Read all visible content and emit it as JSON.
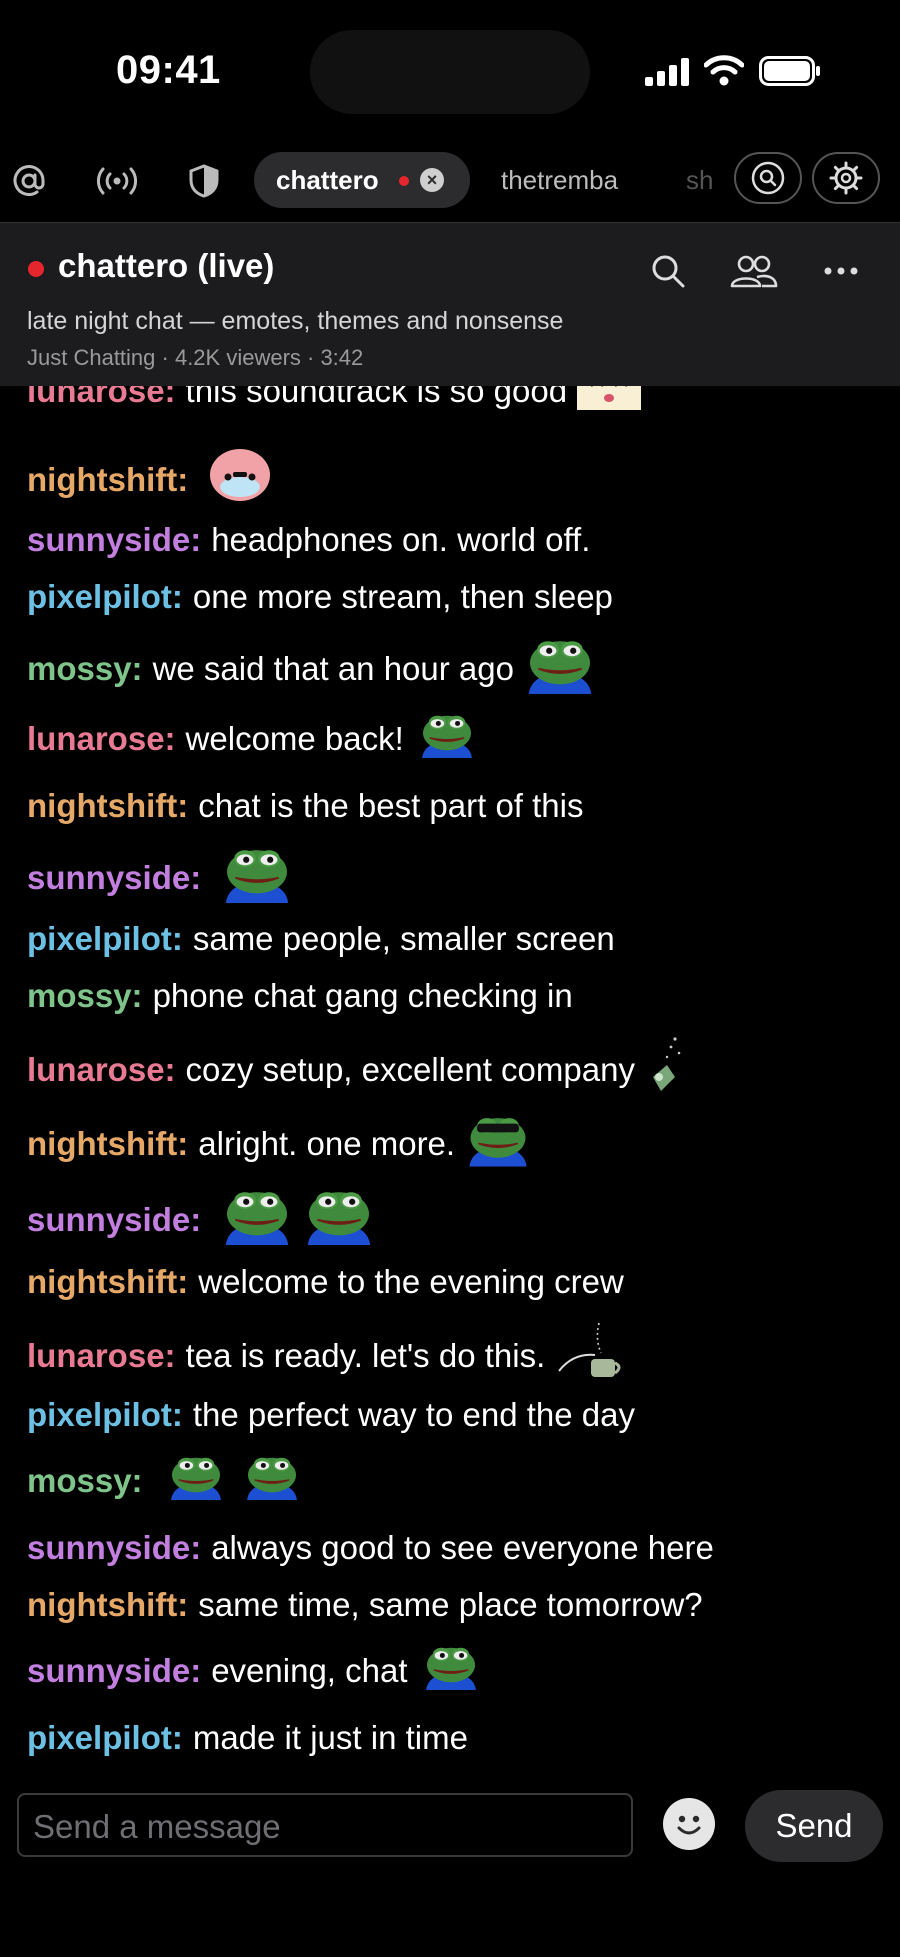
{
  "status_bar": {
    "time": "09:41"
  },
  "tabs": {
    "active": {
      "label": "chattero",
      "live": true
    },
    "others": [
      "thetremba",
      "sh"
    ]
  },
  "stream": {
    "title": "chattero (live)",
    "description": "late night chat — emotes, themes and nonsense",
    "meta": "Just Chatting · 4.2K viewers · 3:42"
  },
  "colors": {
    "lunarose": "#e87a93",
    "nightshift": "#e6a867",
    "sunnyside": "#c27fe0",
    "pixelpilot": "#6cc0e4",
    "mossy": "#7fc58b",
    "live": "#e5262d"
  },
  "messages": [
    {
      "user": "lunarose:",
      "color": "lunarose",
      "text": "this soundtrack is so good",
      "emotes": [
        "anime-face-emote"
      ]
    },
    {
      "user": "nightshift:",
      "color": "nightshift",
      "text": "",
      "emotes": [
        "crying-blob-emote"
      ]
    },
    {
      "user": "sunnyside:",
      "color": "sunnyside",
      "text": "headphones on. world off.",
      "emotes": []
    },
    {
      "user": "pixelpilot:",
      "color": "pixelpilot",
      "text": "one more stream, then sleep",
      "emotes": []
    },
    {
      "user": "mossy:",
      "color": "mossy",
      "text": "we said that an hour ago",
      "emotes": [
        "pepe-emote"
      ]
    },
    {
      "user": "lunarose:",
      "color": "lunarose",
      "text": "welcome back!",
      "emotes": [
        "pepe-peek-emote"
      ]
    },
    {
      "user": "nightshift:",
      "color": "nightshift",
      "text": "chat is the best part of this",
      "emotes": []
    },
    {
      "user": "sunnyside:",
      "color": "sunnyside",
      "text": "",
      "emotes": [
        "pepe-emote"
      ]
    },
    {
      "user": "pixelpilot:",
      "color": "pixelpilot",
      "text": "same people, smaller screen",
      "emotes": []
    },
    {
      "user": "mossy:",
      "color": "mossy",
      "text": "phone chat gang checking in",
      "emotes": []
    },
    {
      "user": "lunarose:",
      "color": "lunarose",
      "text": "cozy setup, excellent company",
      "emotes": [
        "sparkle-emote"
      ]
    },
    {
      "user": "nightshift:",
      "color": "nightshift",
      "text": "alright. one more.",
      "emotes": [
        "pepe-sunglasses-emote"
      ]
    },
    {
      "user": "sunnyside:",
      "color": "sunnyside",
      "text": "",
      "emotes": [
        "pepe-emote",
        "pepe-emote"
      ]
    },
    {
      "user": "nightshift:",
      "color": "nightshift",
      "text": "welcome to the evening crew",
      "emotes": []
    },
    {
      "user": "lunarose:",
      "color": "lunarose",
      "text": "tea is ready. let's do this.",
      "emotes": [
        "tea-pour-emote"
      ]
    },
    {
      "user": "pixelpilot:",
      "color": "pixelpilot",
      "text": "the perfect way to end the day",
      "emotes": []
    },
    {
      "user": "mossy:",
      "color": "mossy",
      "text": "",
      "emotes": [
        "pepe-peek-emote",
        "pepe-peek-emote"
      ]
    },
    {
      "user": "sunnyside:",
      "color": "sunnyside",
      "text": "always good to see everyone here",
      "emotes": []
    },
    {
      "user": "nightshift:",
      "color": "nightshift",
      "text": "same time, same place tomorrow?",
      "emotes": []
    },
    {
      "user": "sunnyside:",
      "color": "sunnyside",
      "text": "evening, chat",
      "emotes": [
        "pepe-peek-emote"
      ]
    },
    {
      "user": "pixelpilot:",
      "color": "pixelpilot",
      "text": "made it just in time",
      "emotes": []
    }
  ],
  "composer": {
    "placeholder": "Send a message",
    "send_label": "Send"
  }
}
